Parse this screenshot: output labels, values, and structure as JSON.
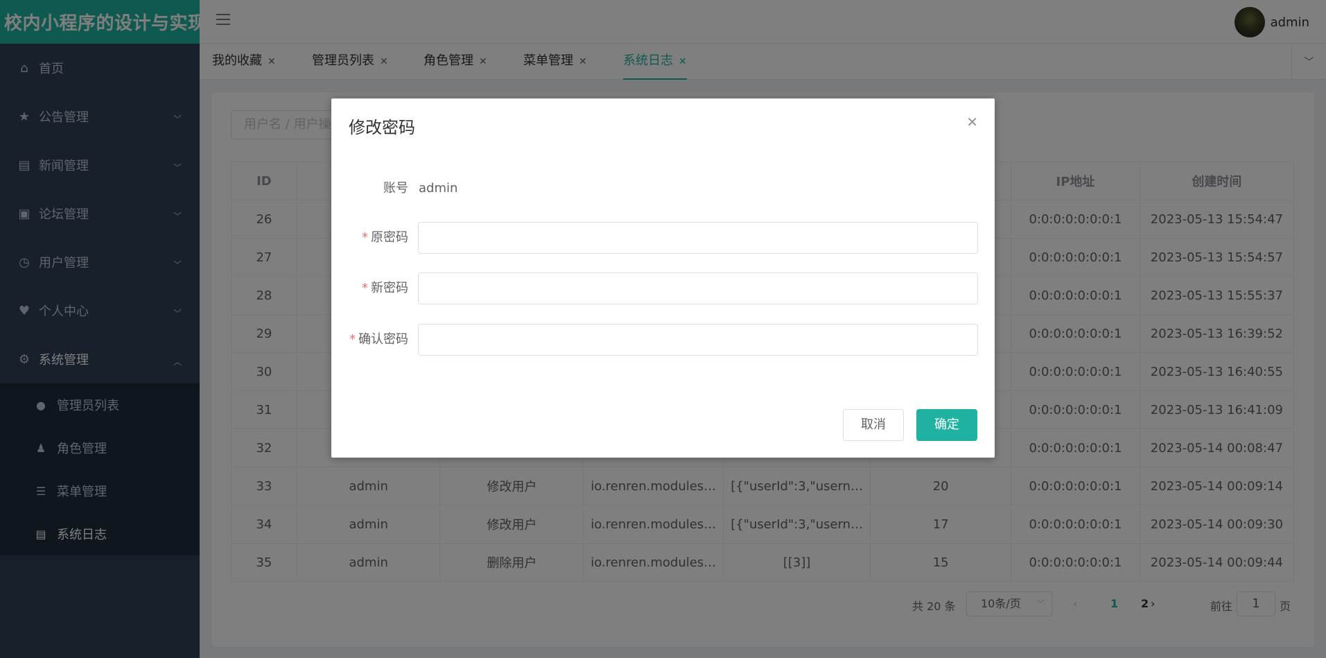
{
  "app": {
    "title": "校内小程序的设计与实现"
  },
  "sidebar": {
    "items": [
      {
        "label": "首页",
        "icon": "home-icon",
        "glyph": "⌂"
      },
      {
        "label": "公告管理",
        "icon": "star-icon",
        "glyph": "★"
      },
      {
        "label": "新闻管理",
        "icon": "document-icon",
        "glyph": "▤"
      },
      {
        "label": "论坛管理",
        "icon": "picture-icon",
        "glyph": "▣"
      },
      {
        "label": "用户管理",
        "icon": "clock-icon",
        "glyph": "◷"
      },
      {
        "label": "个人中心",
        "icon": "heart-icon",
        "glyph": "♥"
      },
      {
        "label": "系统管理",
        "icon": "gear-icon",
        "glyph": "⚙"
      }
    ],
    "sub_items": [
      {
        "label": "管理员列表",
        "icon": "user-icon",
        "glyph": "👤"
      },
      {
        "label": "角色管理",
        "icon": "role-icon",
        "glyph": "♟"
      },
      {
        "label": "菜单管理",
        "icon": "list-icon",
        "glyph": "☰"
      },
      {
        "label": "系统日志",
        "icon": "document-icon",
        "glyph": "▤"
      }
    ]
  },
  "header": {
    "username": "admin"
  },
  "tabs": [
    {
      "label": "我的收藏"
    },
    {
      "label": "管理员列表"
    },
    {
      "label": "角色管理"
    },
    {
      "label": "菜单管理"
    },
    {
      "label": "系统日志"
    }
  ],
  "search": {
    "placeholder": "用户名 / 用户操作"
  },
  "table": {
    "headers": [
      "ID",
      "",
      "",
      "",
      "",
      "",
      "IP地址",
      "创建时间"
    ],
    "rows": [
      [
        "26",
        "",
        "",
        "",
        "",
        "",
        "0:0:0:0:0:0:0:1",
        "2023-05-13 15:54:47"
      ],
      [
        "27",
        "",
        "",
        "",
        "",
        "",
        "0:0:0:0:0:0:0:1",
        "2023-05-13 15:54:57"
      ],
      [
        "28",
        "",
        "",
        "",
        "",
        "",
        "0:0:0:0:0:0:0:1",
        "2023-05-13 15:55:37"
      ],
      [
        "29",
        "",
        "",
        "",
        "",
        "",
        "0:0:0:0:0:0:0:1",
        "2023-05-13 16:39:52"
      ],
      [
        "30",
        "",
        "",
        "",
        "",
        "",
        "0:0:0:0:0:0:0:1",
        "2023-05-13 16:40:55"
      ],
      [
        "31",
        "",
        "",
        "",
        "",
        "",
        "0:0:0:0:0:0:0:1",
        "2023-05-13 16:41:09"
      ],
      [
        "32",
        "",
        "",
        "",
        "",
        "",
        "0:0:0:0:0:0:0:1",
        "2023-05-14 00:08:47"
      ],
      [
        "33",
        "admin",
        "修改用户",
        "io.renren.modules…",
        "[{\"userId\":3,\"usern…",
        "20",
        "0:0:0:0:0:0:0:1",
        "2023-05-14 00:09:14"
      ],
      [
        "34",
        "admin",
        "修改用户",
        "io.renren.modules…",
        "[{\"userId\":3,\"usern…",
        "17",
        "0:0:0:0:0:0:0:1",
        "2023-05-14 00:09:30"
      ],
      [
        "35",
        "admin",
        "删除用户",
        "io.renren.modules…",
        "[[3]]",
        "15",
        "0:0:0:0:0:0:0:1",
        "2023-05-14 00:09:44"
      ]
    ]
  },
  "pagination": {
    "total": "共 20 条",
    "page_size": "10条/页",
    "pages": [
      "1",
      "2"
    ],
    "goto_label": "前往",
    "goto_value": "1",
    "page_suffix": "页"
  },
  "dialog": {
    "title": "修改密码",
    "account_label": "账号",
    "account_value": "admin",
    "old_password_label": "原密码",
    "new_password_label": "新密码",
    "confirm_password_label": "确认密码",
    "required_mark": "*",
    "cancel_label": "取消",
    "ok_label": "确定"
  },
  "colors": {
    "accent": "#20b2a0",
    "sidebar_bg": "#304156",
    "required": "#f56c6c"
  }
}
